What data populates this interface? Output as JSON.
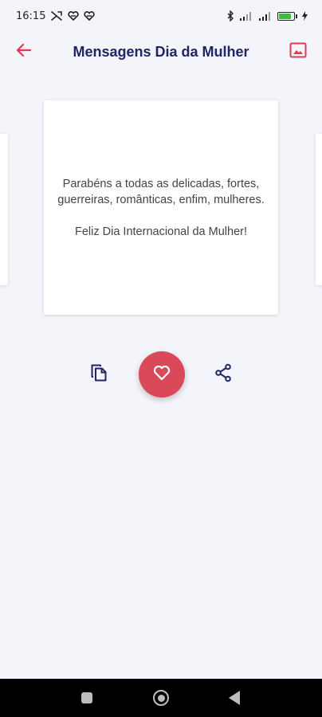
{
  "status_bar": {
    "time": "16:15",
    "battery_level": 0.85,
    "icons": [
      "notification-icon",
      "heart-notification-icon",
      "heart-notification-icon",
      "bluetooth-icon",
      "signal-icon",
      "signal-icon",
      "battery-icon",
      "charging-icon"
    ]
  },
  "app_bar": {
    "title": "Mensagens Dia da Mulher",
    "back_icon": "arrow-left-icon",
    "image_icon": "image-icon"
  },
  "message": {
    "body": "Parabéns a todas as delicadas, fortes, guerreiras, românticas, enfim, mulheres.",
    "closing": "Feliz Dia Internacional da Mulher!"
  },
  "actions": {
    "copy_icon": "copy-icon",
    "favorite_icon": "heart-icon",
    "share_icon": "share-icon"
  },
  "colors": {
    "accent": "#e53950",
    "title": "#1f2566",
    "favorite_bg": "#d9495a",
    "background": "#f4f5fa"
  }
}
